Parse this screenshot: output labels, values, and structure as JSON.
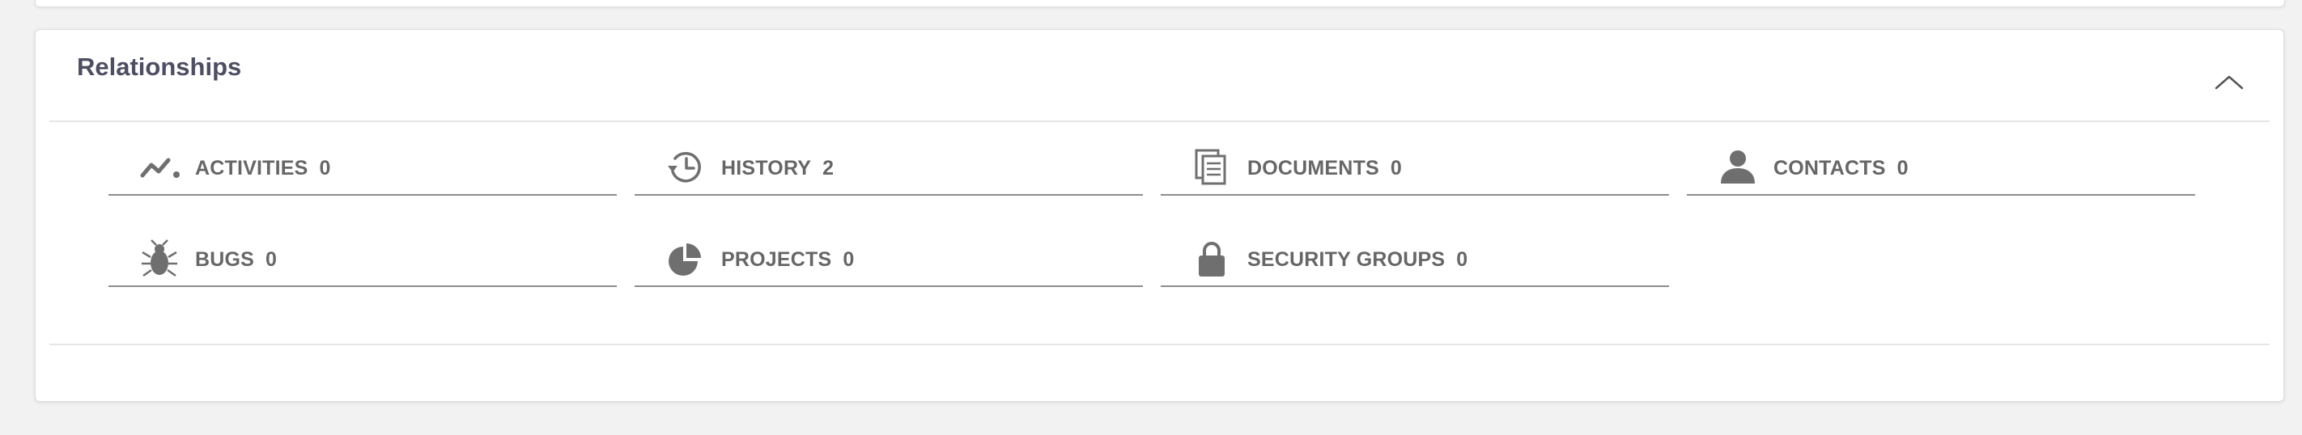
{
  "panel": {
    "title": "Relationships"
  },
  "relationships": [
    {
      "label": "ACTIVITIES",
      "count": "0",
      "icon": "activities-icon"
    },
    {
      "label": "HISTORY",
      "count": "2",
      "icon": "history-icon"
    },
    {
      "label": "DOCUMENTS",
      "count": "0",
      "icon": "documents-icon"
    },
    {
      "label": "CONTACTS",
      "count": "0",
      "icon": "contact-person-icon"
    },
    {
      "label": "BUGS",
      "count": "0",
      "icon": "bug-icon"
    },
    {
      "label": "PROJECTS",
      "count": "0",
      "icon": "pie-chart-icon"
    },
    {
      "label": "SECURITY GROUPS",
      "count": "0",
      "icon": "lock-icon"
    }
  ],
  "colors": {
    "title": "#4d4d63",
    "label": "#666666",
    "icon": "#6f6f6f",
    "underline": "#8c8c8c"
  }
}
